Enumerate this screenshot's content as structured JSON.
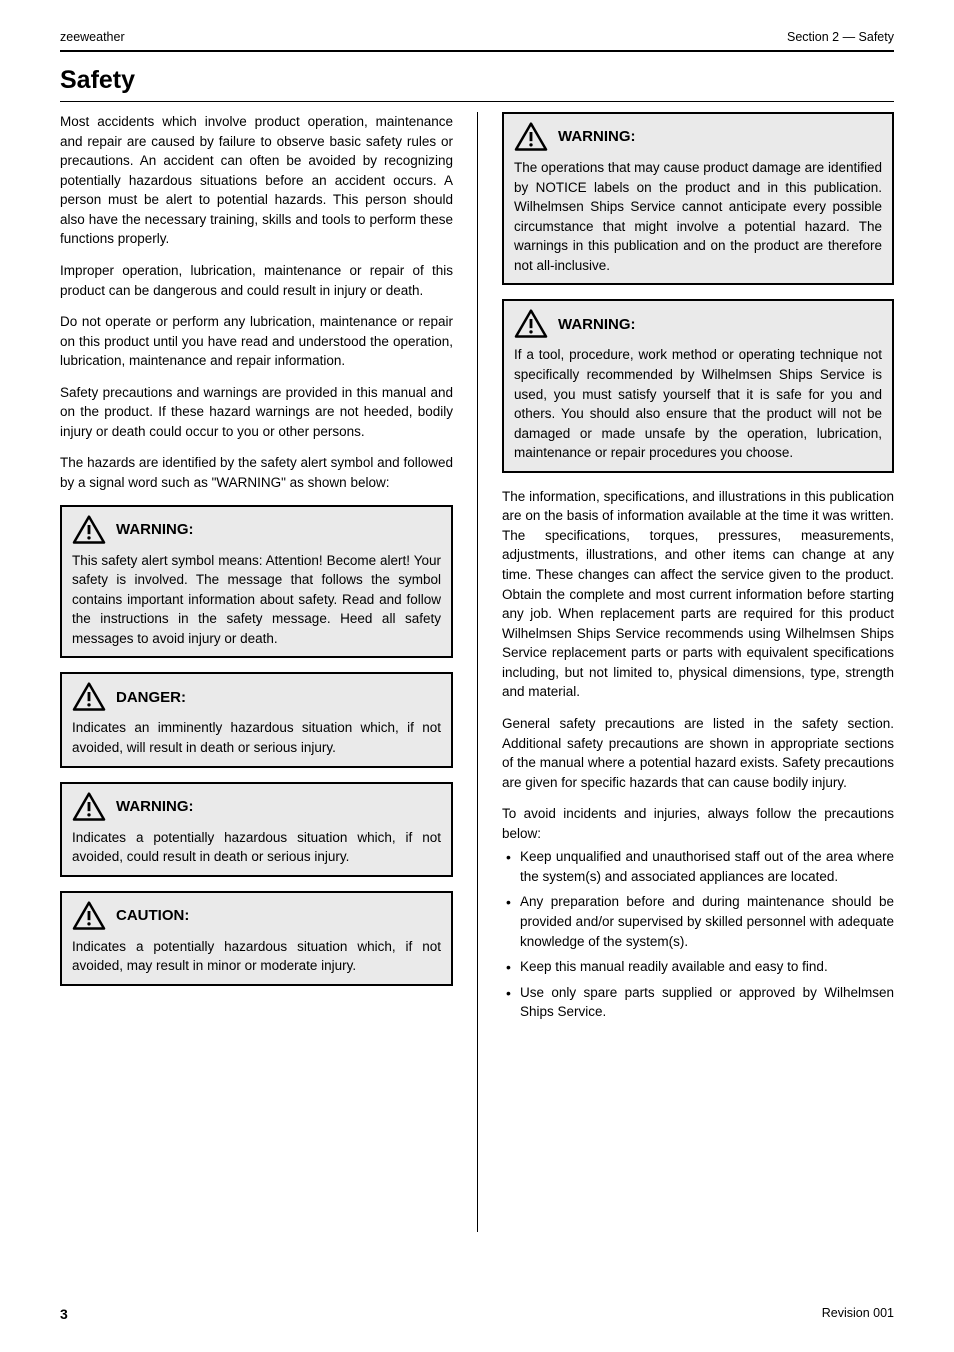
{
  "header": {
    "product": "zeeweather",
    "section_label": "Section 2 — Safety",
    "section_title": "Safety"
  },
  "left": {
    "intro1": "Most accidents which involve product operation, maintenance and repair are caused by failure to observe basic safety rules or precautions. An accident can often be avoided by recognizing potentially hazardous situations before an accident occurs. A person must be alert to potential hazards. This person should also have the necessary training, skills and tools to perform these functions properly.",
    "intro2": "Improper operation, lubrication, maintenance or repair of this product can be dangerous and could result in injury or death.",
    "intro3": "Do not operate or perform any lubrication, maintenance or repair on this product until you have read and understood the operation, lubrication, maintenance and repair information.",
    "intro4": "Safety precautions and warnings are provided in this manual and on the product. If these hazard warnings are not heeded, bodily injury or death could occur to you or other persons.",
    "intro5": "The hazards are identified by the safety alert symbol and followed by a signal word such as \"WARNING\" as shown below:",
    "warn1_label": "WARNING:",
    "warn1_body": "This safety alert symbol means: Attention! Become alert! Your safety is involved. The message that follows the symbol contains important information about safety. Read and follow the instructions in the safety message. Heed all safety messages to avoid injury or death.",
    "warn2_label": "DANGER:",
    "warn2_body": "Indicates an imminently hazardous situation which, if not avoided, will result in death or serious injury.",
    "warn3_label": "WARNING:",
    "warn3_body": "Indicates a potentially hazardous situation which, if not avoided, could result in death or serious injury.",
    "warn4_label": "CAUTION:",
    "warn4_body": "Indicates a potentially hazardous situation which, if not avoided, may result in minor or moderate injury."
  },
  "right": {
    "warn5_label": "WARNING:",
    "warn5_body": "The operations that may cause product damage are identified by NOTICE labels on the product and in this publication. Wilhelmsen Ships Service cannot anticipate every possible circumstance that might involve a potential hazard. The warnings in this publication and on the product are therefore not all-inclusive.",
    "warn6_label": "WARNING:",
    "warn6_body": "If a tool, procedure, work method or operating technique not specifically recommended by Wilhelmsen Ships Service is used, you must satisfy yourself that it is safe for you and others. You should also ensure that the product will not be damaged or made unsafe by the operation, lubrication, maintenance or repair procedures you choose.",
    "para1": "The information, specifications, and illustrations in this publication are on the basis of information available at the time it was written. The specifications, torques, pressures, measurements, adjustments, illustrations, and other items can change at any time. These changes can affect the service given to the product. Obtain the complete and most current information before starting any job. When replacement parts are required for this product Wilhelmsen Ships Service recommends using Wilhelmsen Ships Service replacement parts or parts with equivalent specifications including, but not limited to, physical dimensions, type, strength and material.",
    "para2": "General safety precautions are listed in the safety section. Additional safety precautions are shown in appropriate sections of the manual where a potential hazard exists. Safety precautions are given for specific hazards that can cause bodily injury.",
    "bullet_intro": "To avoid incidents and injuries, always follow the precautions below:",
    "bullets": [
      "Keep unqualified and unauthorised staff out of the area where the system(s) and associated appliances are located.",
      "Any preparation before and during maintenance should be provided and/or supervised by skilled personnel with adequate knowledge of the system(s).",
      "Keep this manual readily available and easy to find.",
      "Use only spare parts supplied or approved by Wilhelmsen Ships Service."
    ]
  },
  "footer": {
    "page": "3",
    "revision": "Revision 001"
  }
}
